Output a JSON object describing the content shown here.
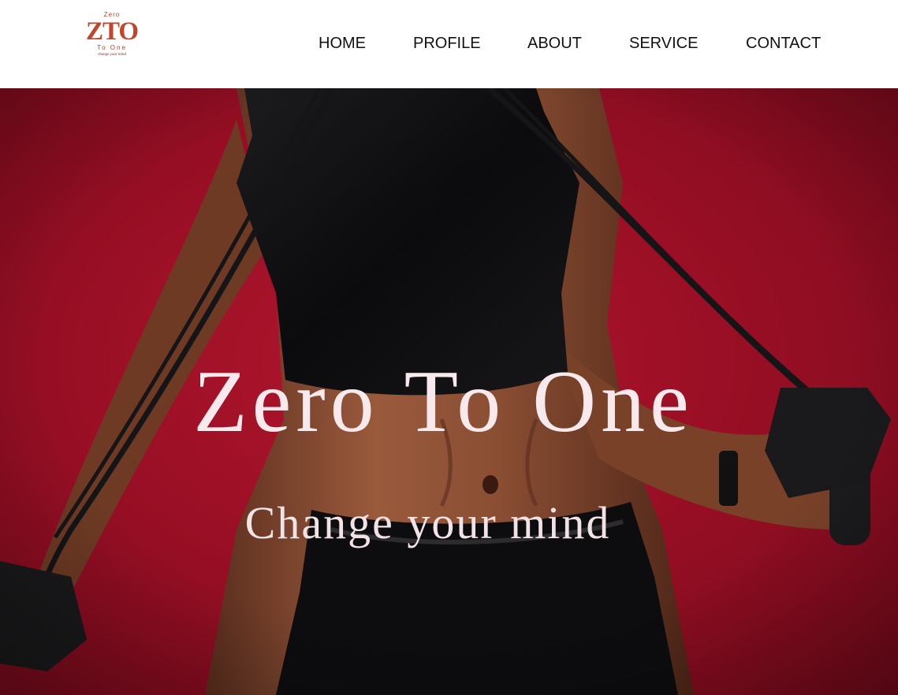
{
  "brand": {
    "logo_top": "Zero",
    "logo_main": "ZTO",
    "logo_sub": "To One",
    "logo_tag": "change your mind",
    "color": "#c2462b"
  },
  "nav": {
    "items": [
      {
        "label": "HOME"
      },
      {
        "label": "PROFILE"
      },
      {
        "label": "ABOUT"
      },
      {
        "label": "SERVICE"
      },
      {
        "label": "CONTACT"
      }
    ]
  },
  "hero": {
    "title": "Zero To One",
    "subtitle": "Change your mind",
    "background_color": "#9a0f25",
    "text_color": "#f7e9ec"
  }
}
